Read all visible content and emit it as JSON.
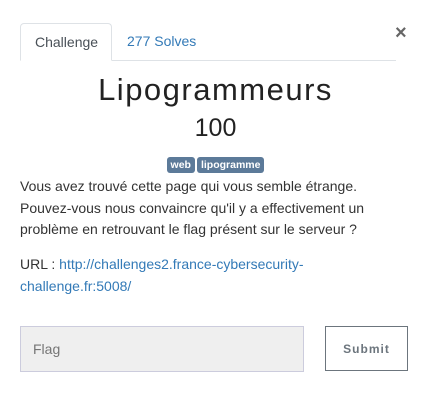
{
  "tabs": [
    {
      "label": "Challenge"
    },
    {
      "label": "277 Solves"
    }
  ],
  "close_label": "×",
  "challenge": {
    "name": "Lipogrammeurs",
    "value": "100",
    "tags": [
      "web",
      "lipogramme"
    ],
    "description": "Vous avez trouvé cette page qui vous semble étrange. Pouvez-vous nous convaincre qu'il y a effectivement un problème en retrouvant le flag présent sur le serveur ?",
    "url_label": "URL : ",
    "url": "http://challenges2.france-cybersecurity-challenge.fr:5008/"
  },
  "form": {
    "flag_placeholder": "Flag",
    "flag_value": "",
    "submit_label": "Submit"
  },
  "colors": {
    "link": "#337ab7",
    "tag": "#5c7a99"
  }
}
